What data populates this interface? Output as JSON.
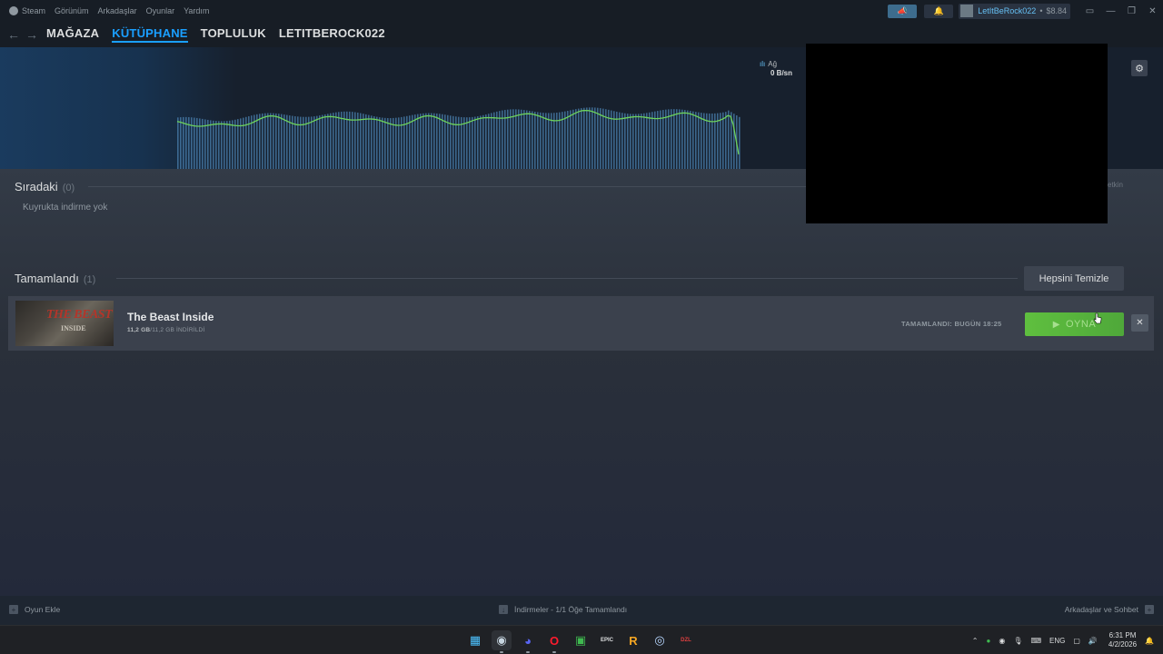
{
  "menu": {
    "items": [
      "Steam",
      "Görünüm",
      "Arkadaşlar",
      "Oyunlar",
      "Yardım"
    ],
    "user_name": "LetItBeRock022",
    "balance": "$8.84",
    "separator": "•"
  },
  "nav": {
    "back_icon": "←",
    "forward_icon": "→",
    "tabs": [
      "MAĞAZA",
      "KÜTÜPHANE",
      "TOPLULUK",
      "LETITBEROCK022"
    ],
    "active_tab": "KÜTÜPHANE"
  },
  "network": {
    "label": "Ağ",
    "value": "0 B/sn"
  },
  "queue": {
    "title": "Sıradaki",
    "count": "(0)",
    "empty_text": "Kuyrukta indirme yok",
    "right_fragment": "etkin"
  },
  "completed": {
    "title": "Tamamlandı",
    "count": "(1)",
    "clear_all_label": "Hepsini Temizle",
    "items": [
      {
        "title": "The Beast Inside",
        "size_done": "11,2 GB",
        "size_total": "/11,2 GB İNDİRİLDİ",
        "thumb_line1": "THE BEAST",
        "thumb_line2": "INSIDE",
        "completed_label": "TAMAMLANDI: BUGÜN 18:25",
        "play_label": "OYNA",
        "remove_icon": "✕"
      }
    ]
  },
  "statusbar": {
    "add_game": "Oyun Ekle",
    "downloads": "İndirmeler - 1/1 Öğe Tamamlandı",
    "friends_chat": "Arkadaşlar ve Sohbet"
  },
  "taskbar": {
    "language": "ENG",
    "time": "6:31 PM",
    "date": "4/2/2026",
    "icons": [
      {
        "name": "windows-start-icon",
        "glyph": "▦",
        "color": "#4cc2ff"
      },
      {
        "name": "steam-icon",
        "glyph": "◉",
        "color": "#c7d5e0"
      },
      {
        "name": "discord-icon",
        "glyph": "◕",
        "color": "#5865f2"
      },
      {
        "name": "opera-icon",
        "glyph": "O",
        "color": "#ff1b2d"
      },
      {
        "name": "chat-app-icon",
        "glyph": "▣",
        "color": "#3fb950"
      },
      {
        "name": "epic-games-icon",
        "glyph": "EPIC",
        "color": "#dcdedf"
      },
      {
        "name": "rockstar-icon",
        "glyph": "R",
        "color": "#f5a623"
      },
      {
        "name": "ubisoft-icon",
        "glyph": "◎",
        "color": "#b8d7ff"
      },
      {
        "name": "ezl-app-icon",
        "glyph": "DZL",
        "color": "#e04040"
      }
    ]
  },
  "colors": {
    "accent": "#1a9fff",
    "play_green": "#59bf40",
    "graph_line": "#6ed35b",
    "graph_bar": "#4a7fae"
  }
}
